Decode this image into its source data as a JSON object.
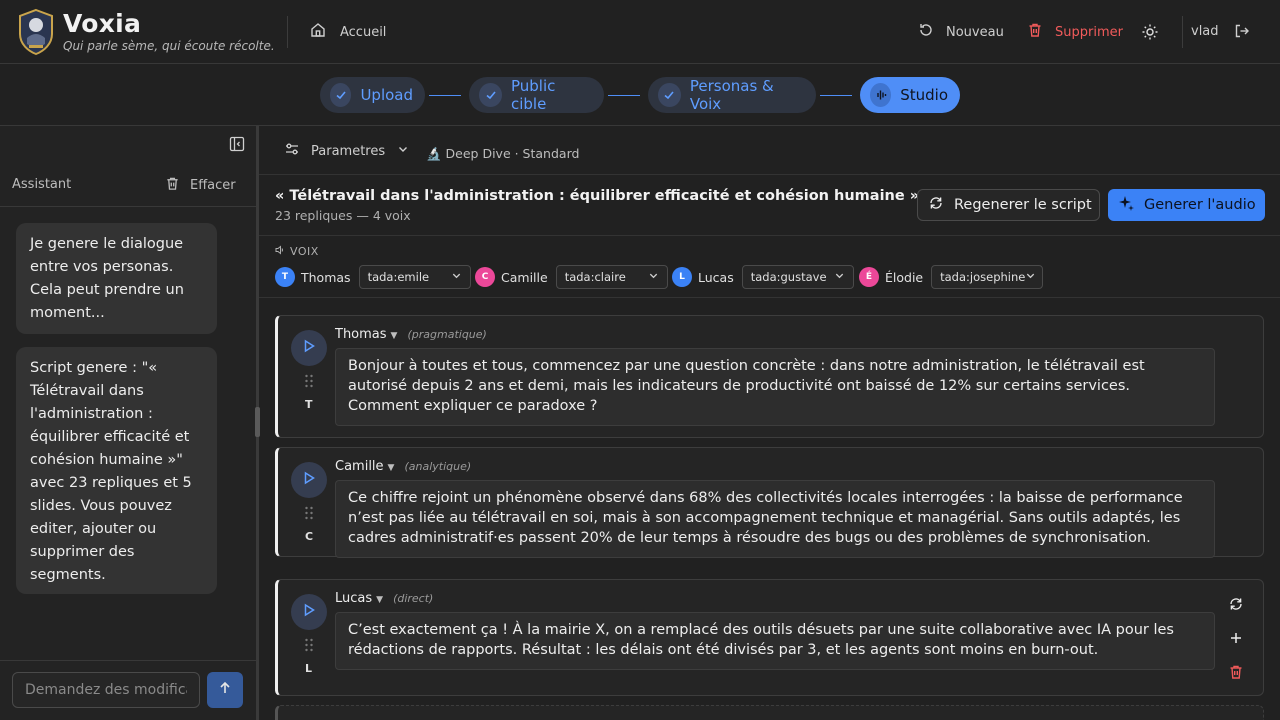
{
  "brand": {
    "name": "Voxia",
    "tagline": "Qui parle sème, qui écoute récolte."
  },
  "header": {
    "home": "Accueil",
    "new_label": "Nouveau",
    "delete_label": "Supprimer",
    "user": "vlad"
  },
  "steps": [
    {
      "label": "Upload",
      "state": "done"
    },
    {
      "label": "Public cible",
      "state": "done"
    },
    {
      "label": "Personas & Voix",
      "state": "done"
    },
    {
      "label": "Studio",
      "state": "active"
    }
  ],
  "sidebar": {
    "title": "Assistant",
    "clear_label": "Effacer",
    "messages": [
      "Je genere le dialogue entre vos personas. Cela peut prendre un moment...",
      "Script genere : \"« Télétravail dans l'administration : équilibrer efficacité et cohésion humaine »\" avec 23 repliques et 5 slides. Vous pouvez editer, ajouter ou supprimer des segments."
    ],
    "input_placeholder": "Demandez des modifications..."
  },
  "toolbar": {
    "params_label": "Parametres",
    "mode": "🔬 Deep Dive · Standard"
  },
  "script": {
    "title": "« Télétravail dans l'administration : équilibrer efficacité et cohésion humaine »",
    "subtitle": "23 repliques — 4 voix",
    "regen_label": "Regenerer le script",
    "generate_label": "Generer l'audio"
  },
  "voices": {
    "label": "VOIX",
    "items": [
      {
        "initial": "T",
        "name": "Thomas",
        "voice": "tada:emile",
        "color": "#3b82f6"
      },
      {
        "initial": "C",
        "name": "Camille",
        "voice": "tada:claire",
        "color": "#ec4899"
      },
      {
        "initial": "L",
        "name": "Lucas",
        "voice": "tada:gustave",
        "color": "#3b82f6"
      },
      {
        "initial": "É",
        "name": "Élodie",
        "voice": "tada:josephine",
        "color": "#ec4899"
      }
    ]
  },
  "segments": [
    {
      "speaker": "Thomas",
      "initial": "T",
      "role": "(pragmatique)",
      "text": "Bonjour à toutes et tous, commencez par une question concrète : dans notre administration, le télétravail est autorisé depuis 2 ans et demi, mais les indicateurs de productivité ont baissé de 12% sur certains services. Comment expliquer ce paradoxe ?"
    },
    {
      "speaker": "Camille",
      "initial": "C",
      "role": "(analytique)",
      "text": "Ce chiffre rejoint un phénomène observé dans 68% des collectivités locales interrogées : la baisse de performance n’est pas liée au télétravail en soi, mais à son accompagnement technique et managérial. Sans outils adaptés, les cadres administratif·es passent 20% de leur temps à résoudre des bugs ou des problèmes de synchronisation."
    },
    {
      "speaker": "Lucas",
      "initial": "L",
      "role": "(direct)",
      "text": "C’est exactement ça ! À la mairie X, on a remplacé des outils désuets par une suite collaborative avec IA pour les rédactions de rapports. Résultat : les délais ont été divisés par 3, et les agents sont moins en burn-out."
    }
  ],
  "colors": {
    "accent": "#3b82f6",
    "danger": "#f15b5b",
    "background": "#212121"
  }
}
